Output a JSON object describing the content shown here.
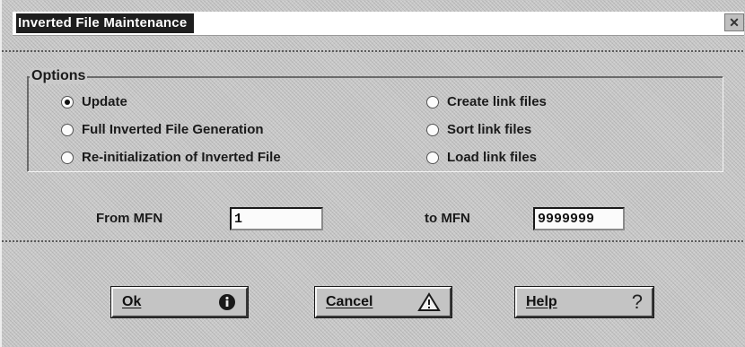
{
  "window": {
    "title": "Inverted File Maintenance",
    "close_glyph": "✕"
  },
  "options": {
    "legend": "Options",
    "items": [
      {
        "label": "Update",
        "checked": true
      },
      {
        "label": "Full Inverted File Generation",
        "checked": false
      },
      {
        "label": "Re-initialization of Inverted File",
        "checked": false
      },
      {
        "label": "Create link files",
        "checked": false
      },
      {
        "label": "Sort link files",
        "checked": false
      },
      {
        "label": "Load link files",
        "checked": false
      }
    ]
  },
  "range": {
    "from_label": "From MFN",
    "from_value": "1",
    "to_label": "to MFN",
    "to_value": "9999999"
  },
  "buttons": {
    "ok": {
      "label": "Ok",
      "icon": "info-icon"
    },
    "cancel": {
      "label": "Cancel",
      "icon": "warning-triangle-icon"
    },
    "help": {
      "label": "Help",
      "icon": "question-mark-icon",
      "glyph": "?"
    }
  }
}
